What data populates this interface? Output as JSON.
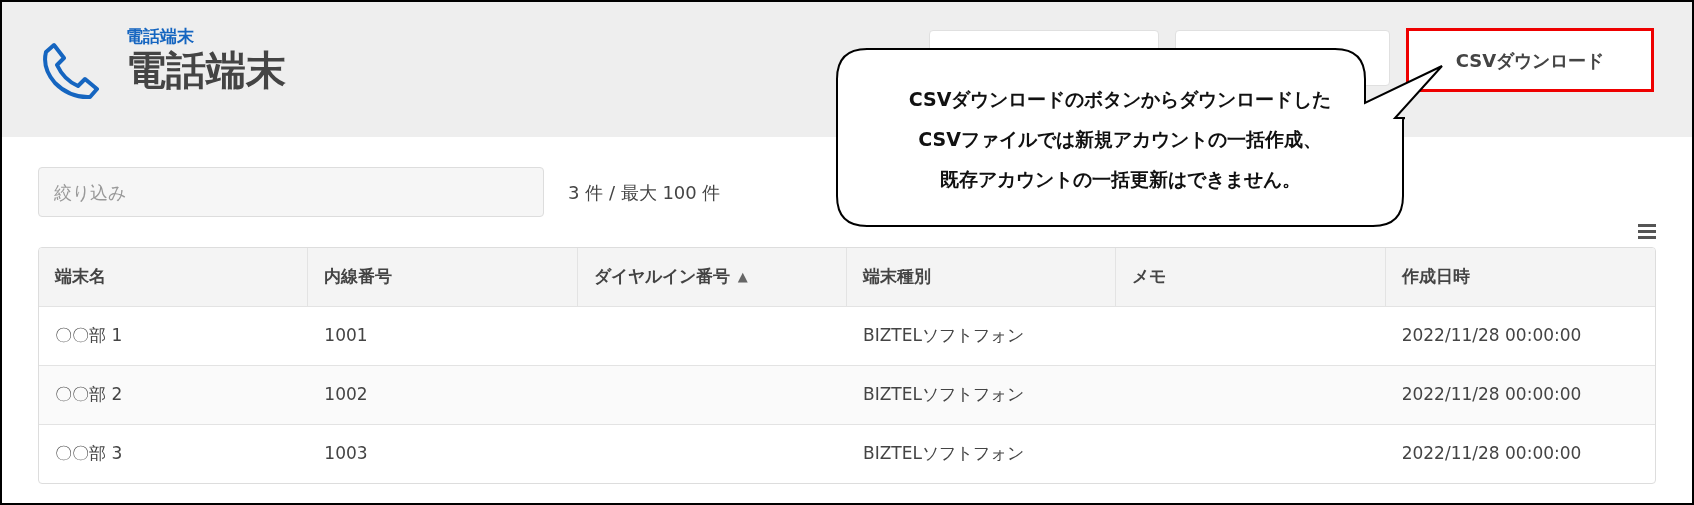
{
  "header": {
    "subtitle": "電話端末",
    "title": "電話端末"
  },
  "header_buttons": [
    {
      "kind": "covered"
    },
    {
      "kind": "covered"
    },
    {
      "kind": "label",
      "label": "CSVダウンロード",
      "highlighted": true
    }
  ],
  "callout": {
    "lines": [
      "CSVダウンロードのボタンからダウンロードした",
      "CSVファイルでは新規アカウントの一括作成、",
      "既存アカウントの一括更新はできません。"
    ]
  },
  "filter": {
    "placeholder": "絞り込み"
  },
  "count": "3 件 / 最大 100 件",
  "table": {
    "columns": [
      {
        "label": "端末名"
      },
      {
        "label": "内線番号"
      },
      {
        "label": "ダイヤルイン番号",
        "sort": "▲"
      },
      {
        "label": "端末種別"
      },
      {
        "label": "メモ"
      },
      {
        "label": "作成日時"
      }
    ],
    "rows": [
      [
        "〇〇部 1",
        "1001",
        "",
        "BIZTELソフトフォン",
        "",
        "2022/11/28 00:00:00"
      ],
      [
        "〇〇部 2",
        "1002",
        "",
        "BIZTELソフトフォン",
        "",
        "2022/11/28 00:00:00"
      ],
      [
        "〇〇部 3",
        "1003",
        "",
        "BIZTELソフトフォン",
        "",
        "2022/11/28 00:00:00"
      ]
    ]
  }
}
